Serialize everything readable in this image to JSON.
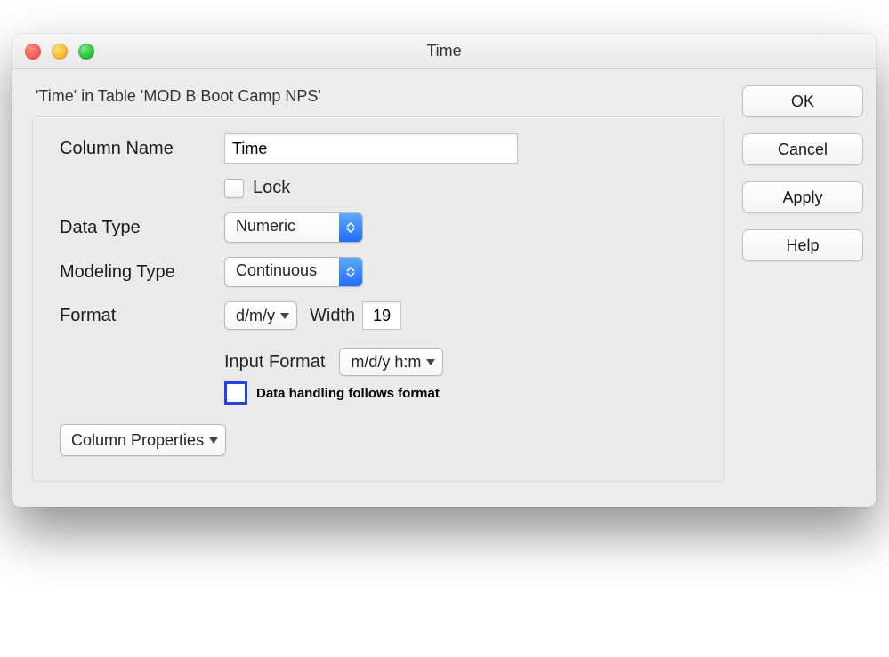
{
  "window": {
    "title": "Time"
  },
  "context_line": "'Time' in Table 'MOD B Boot Camp NPS'",
  "form": {
    "column_name_label": "Column Name",
    "column_name_value": "Time",
    "lock_label": "Lock",
    "data_type_label": "Data Type",
    "data_type_value": "Numeric",
    "modeling_type_label": "Modeling Type",
    "modeling_type_value": "Continuous",
    "format_label": "Format",
    "format_value": "d/m/y",
    "width_label": "Width",
    "width_value": "19",
    "input_format_label": "Input Format",
    "input_format_value": "m/d/y h:m",
    "data_handling_label": "Data handling follows format",
    "column_properties_label": "Column Properties"
  },
  "buttons": {
    "ok": "OK",
    "cancel": "Cancel",
    "apply": "Apply",
    "help": "Help"
  }
}
